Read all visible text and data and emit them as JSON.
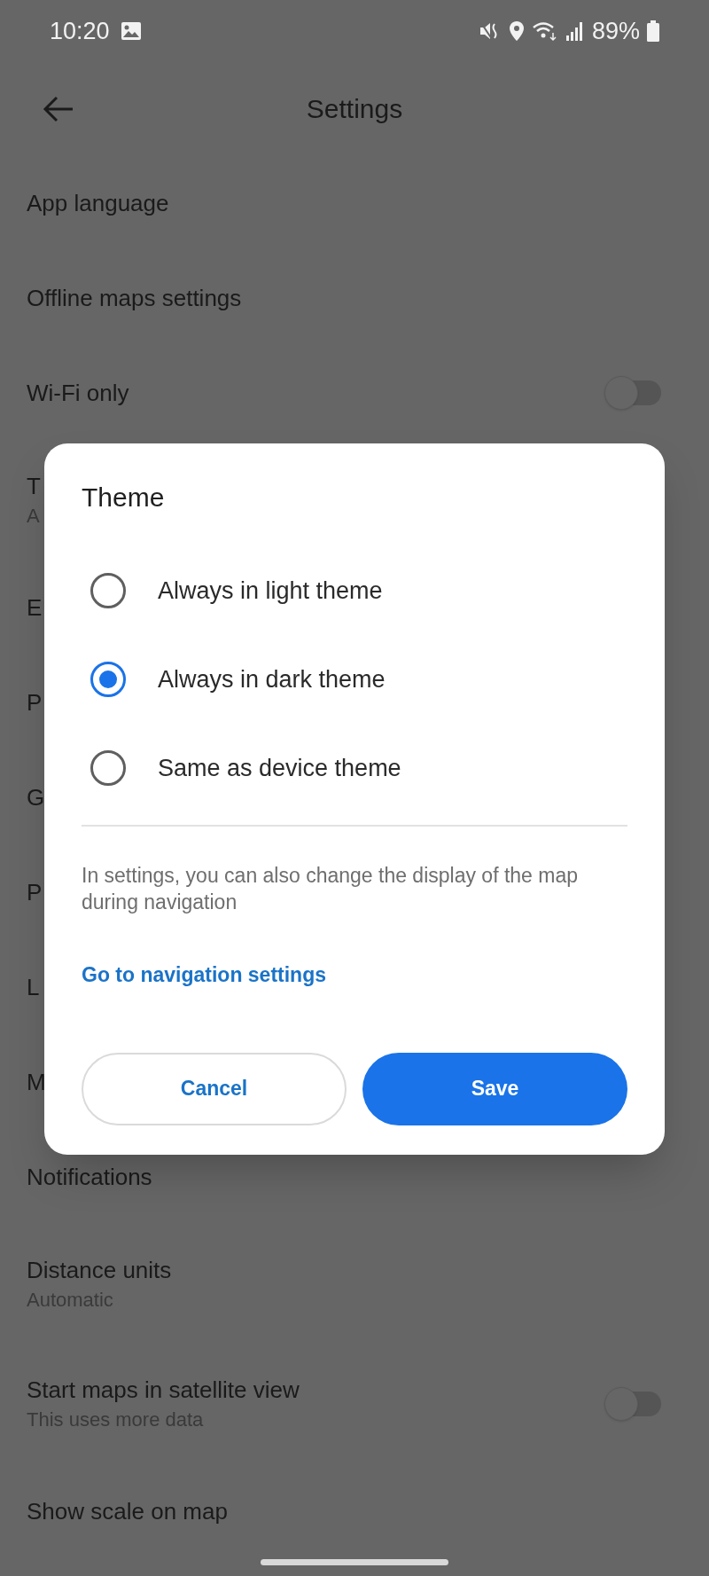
{
  "status_bar": {
    "time": "10:20",
    "battery": "89%"
  },
  "header": {
    "title": "Settings"
  },
  "settings": [
    {
      "kind": "plain",
      "title": "App language"
    },
    {
      "kind": "plain",
      "title": "Offline maps settings"
    },
    {
      "kind": "toggle",
      "title": "Wi-Fi only",
      "on": false
    },
    {
      "kind": "plain",
      "title": "T",
      "subtitle": "A"
    },
    {
      "kind": "plain",
      "title": "E"
    },
    {
      "kind": "plain",
      "title": "P"
    },
    {
      "kind": "plain",
      "title": "G"
    },
    {
      "kind": "plain",
      "title": "P"
    },
    {
      "kind": "plain",
      "title": "L"
    },
    {
      "kind": "plain",
      "title": "M"
    },
    {
      "kind": "plain",
      "title": "Notifications"
    },
    {
      "kind": "plain",
      "title": "Distance units",
      "subtitle": "Automatic"
    },
    {
      "kind": "toggle",
      "title": "Start maps in satellite view",
      "subtitle": "This uses more data",
      "on": false
    },
    {
      "kind": "plain",
      "title": "Show scale on map"
    }
  ],
  "dialog": {
    "title": "Theme",
    "options": [
      {
        "label": "Always in light theme",
        "selected": false
      },
      {
        "label": "Always in dark theme",
        "selected": true
      },
      {
        "label": "Same as device theme",
        "selected": false
      }
    ],
    "note": "In settings, you can also change the display of the map during navigation",
    "link": "Go to navigation settings",
    "buttons": [
      {
        "label": "Cancel",
        "kind": "outline"
      },
      {
        "label": "Save",
        "kind": "filled"
      }
    ]
  }
}
